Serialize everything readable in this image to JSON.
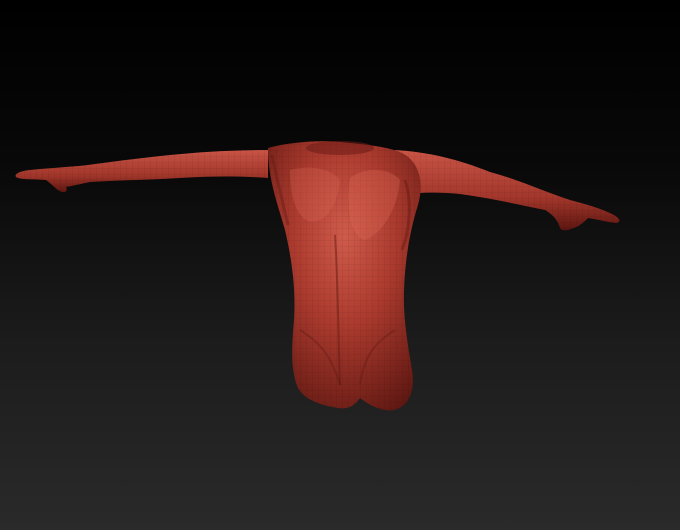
{
  "viewport": {
    "background_top": "#000000",
    "background_bottom": "#2a2a2a",
    "model": {
      "name": "headless-torso-sculpt",
      "material_color": "#a8352a",
      "highlight_color": "#d0594a",
      "shadow_color": "#5a1410",
      "pose": "T-pose",
      "wireframe_overlay": true
    }
  }
}
